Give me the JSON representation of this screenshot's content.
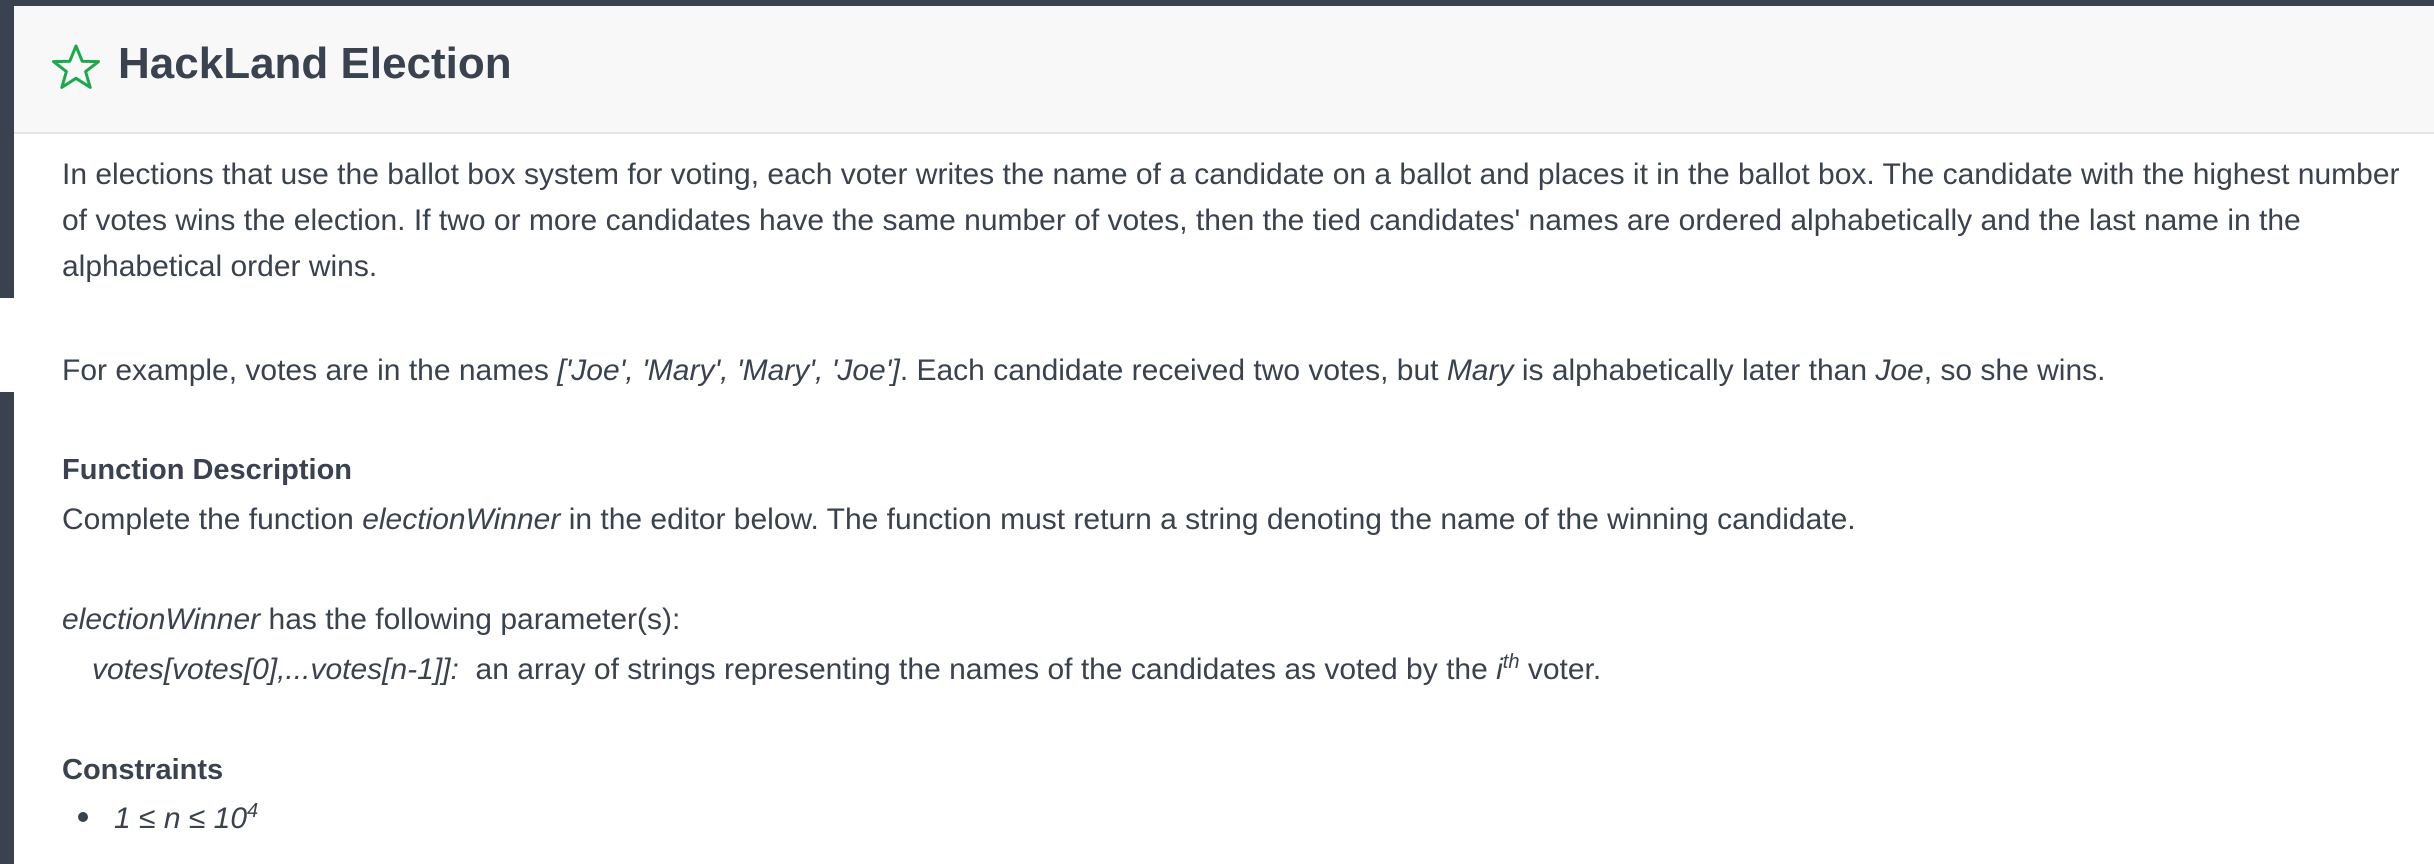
{
  "header": {
    "title": "HackLand Election",
    "star_icon": "star-outline-icon",
    "accent_color": "#1ba94c"
  },
  "intro": {
    "text": "In elections that use the ballot box system for voting, each voter writes the name of a candidate on a ballot and places it in the ballot box. The candidate with the highest number of votes wins the election. If two or more candidates have the same number of votes, then the tied candidates' names are ordered alphabetically and the last name in the alphabetical order wins."
  },
  "example": {
    "prefix": "For example, votes are in the names ",
    "names": "['Joe', 'Mary', 'Mary', 'Joe']",
    "middle": ". Each candidate received two votes, but ",
    "name_later": "Mary",
    "middle2": " is alphabetically later than ",
    "name_earlier": "Joe",
    "suffix": ", so she wins."
  },
  "function_description": {
    "heading": "Function Description",
    "prefix": "Complete the function ",
    "function_name": "electionWinner",
    "suffix": " in the editor below. The function must return a string denoting the name of the winning candidate."
  },
  "parameters": {
    "function_name": "electionWinner",
    "intro_suffix": " has the following parameter(s):",
    "param_signature": "votes[votes[0],...votes[n-1]]:",
    "param_desc_prefix": "  an array of strings representing the names of the candidates as voted by the ",
    "param_i": "i",
    "param_sup": "th",
    "param_desc_suffix": " voter."
  },
  "constraints": {
    "heading": "Constraints",
    "item_base": "1 ≤ n ≤ 10",
    "item_sup": "4"
  },
  "colors": {
    "text": "#39424e",
    "header_bg": "#f8f8f8",
    "sidebar": "#39424e"
  }
}
